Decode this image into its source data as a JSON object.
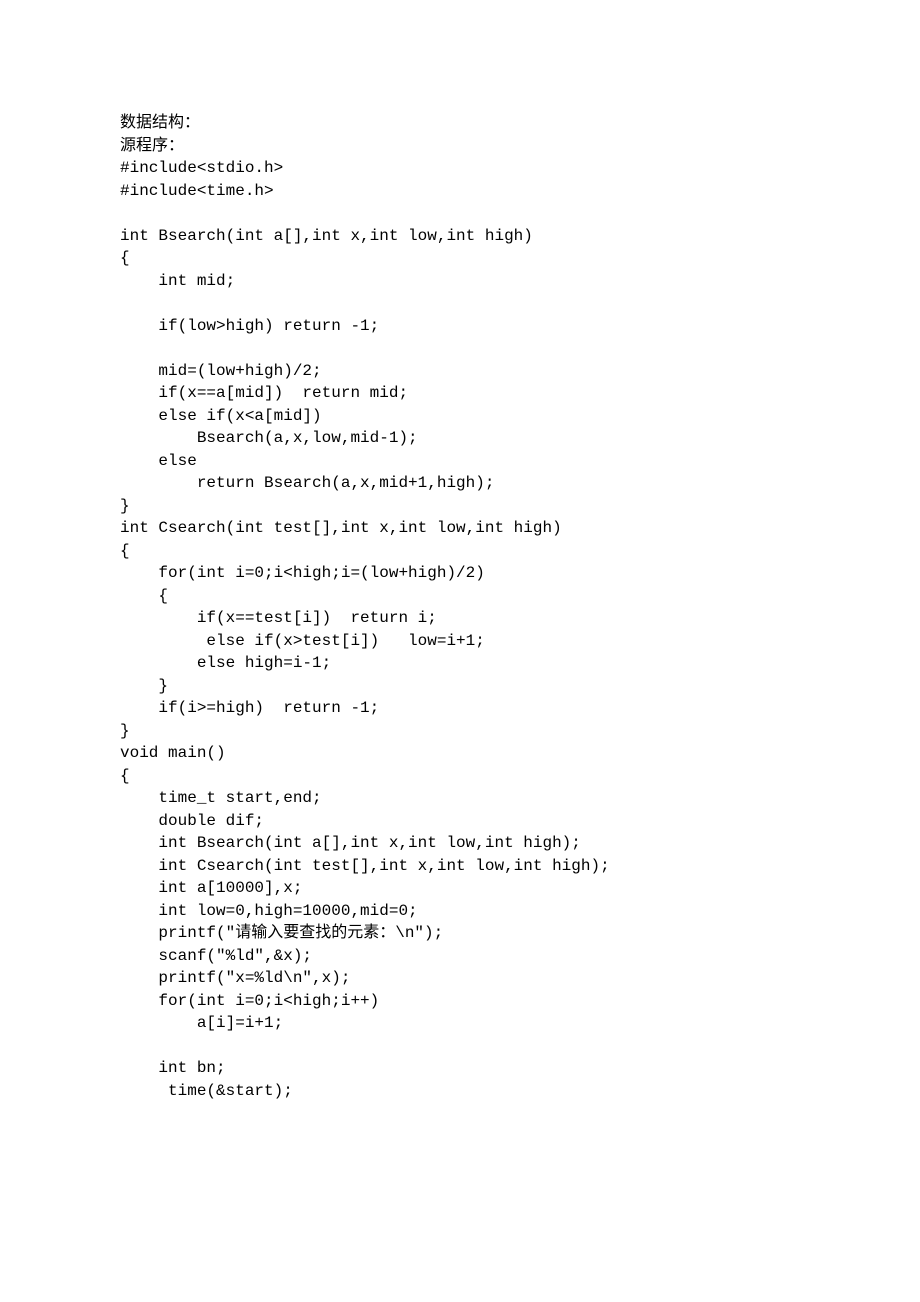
{
  "lines": [
    "数据结构：",
    "源程序：",
    "#include<stdio.h>",
    "#include<time.h>",
    "",
    "int Bsearch(int a[],int x,int low,int high)",
    "{",
    "    int mid;",
    "",
    "    if(low>high) return -1;",
    "",
    "    mid=(low+high)/2;",
    "    if(x==a[mid])  return mid;",
    "    else if(x<a[mid])",
    "        Bsearch(a,x,low,mid-1);",
    "    else",
    "        return Bsearch(a,x,mid+1,high);",
    "}",
    "int Csearch(int test[],int x,int low,int high)",
    "{",
    "    for(int i=0;i<high;i=(low+high)/2)",
    "    {",
    "        if(x==test[i])  return i;",
    "         else if(x>test[i])   low=i+1;",
    "        else high=i-1;",
    "    }",
    "    if(i>=high)  return -1;",
    "}",
    "void main()",
    "{",
    "    time_t start,end;",
    "    double dif;",
    "    int Bsearch(int a[],int x,int low,int high);",
    "    int Csearch(int test[],int x,int low,int high);",
    "    int a[10000],x;",
    "    int low=0,high=10000,mid=0;",
    "    printf(\"请输入要查找的元素：\\n\");",
    "    scanf(\"%ld\",&x);",
    "    printf(\"x=%ld\\n\",x);",
    "    for(int i=0;i<high;i++)",
    "        a[i]=i+1;",
    "",
    "    int bn;",
    "     time(&start);"
  ]
}
